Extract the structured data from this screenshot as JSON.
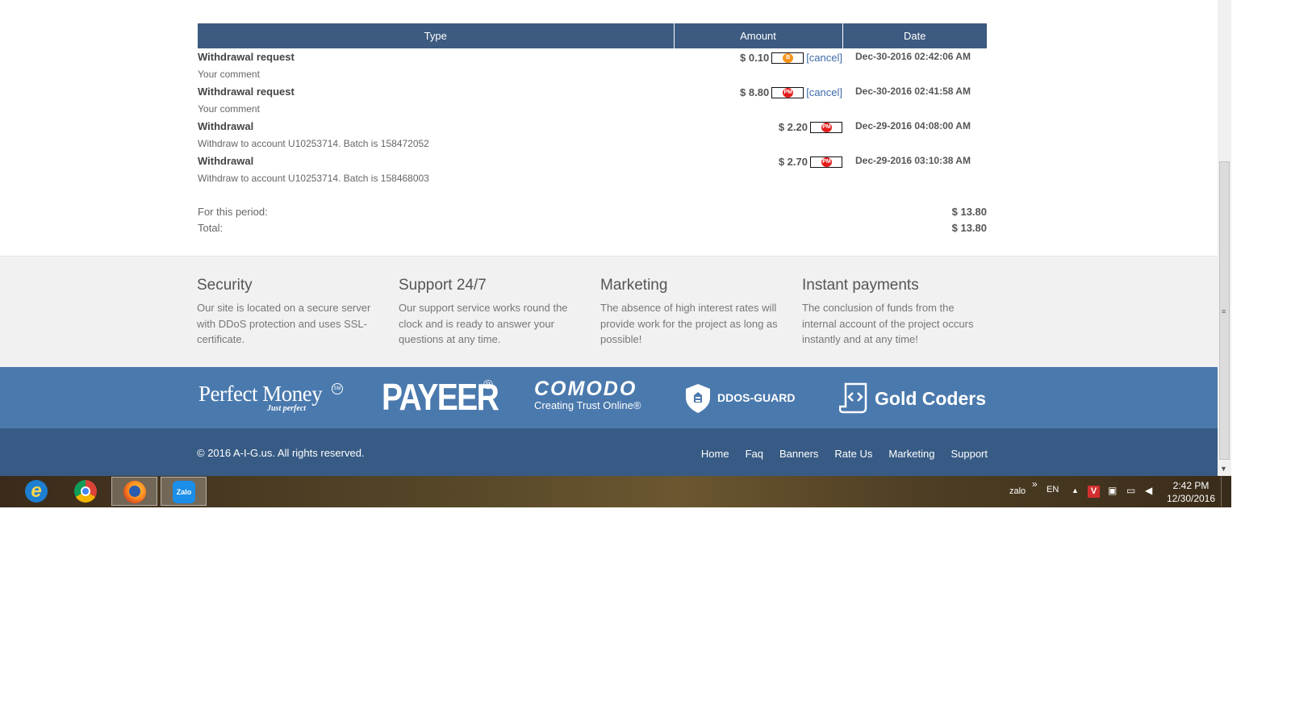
{
  "table": {
    "headers": [
      "Type",
      "Amount",
      "Date"
    ],
    "rows": [
      {
        "title": "Withdrawal request",
        "comment": "Your comment",
        "amount": "$ 0.10",
        "system": "bitcoin-icon",
        "cancel": "[cancel]",
        "date": "Dec-30-2016 02:42:06 AM"
      },
      {
        "title": "Withdrawal request",
        "comment": "Your comment",
        "amount": "$ 8.80",
        "system": "perfect-money-icon",
        "cancel": "[cancel]",
        "date": "Dec-30-2016 02:41:58 AM"
      },
      {
        "title": "Withdrawal",
        "comment": "Withdraw to account U10253714. Batch is 158472052",
        "amount": "$ 2.20",
        "system": "perfect-money-icon",
        "cancel": "",
        "date": "Dec-29-2016 04:08:00 AM"
      },
      {
        "title": "Withdrawal",
        "comment": "Withdraw to account U10253714. Batch is 158468003",
        "amount": "$ 2.70",
        "system": "perfect-money-icon",
        "cancel": "",
        "date": "Dec-29-2016 03:10:38 AM"
      }
    ],
    "coin_btc": "B",
    "coin_pm": "PM",
    "summary": {
      "period_label": "For this period:",
      "period_value": "$ 13.80",
      "total_label": "Total:",
      "total_value": "$ 13.80"
    }
  },
  "features": [
    {
      "title": "Security",
      "text": "Our site is located on a secure server with DDoS protection and uses SSL-certificate."
    },
    {
      "title": "Support 24/7",
      "text": "Our support service works round the clock and is ready to answer your questions at any time."
    },
    {
      "title": "Marketing",
      "text": "The absence of high interest rates will provide work for the project as long as possible!"
    },
    {
      "title": "Instant payments",
      "text": "The conclusion of funds from the internal account of the project occurs instantly and at any time!"
    }
  ],
  "partners": {
    "perfect_money": {
      "name": "Perfect Money",
      "tag": "Just perfect",
      "mark": "SM"
    },
    "payeer": {
      "name": "PAYEER",
      "mark": "®"
    },
    "comodo": {
      "name": "COMODO",
      "tag": "Creating Trust Online®"
    },
    "ddos_guard": {
      "name": "DDOS-GUARD"
    },
    "gold_coders": {
      "name": "Gold Coders"
    }
  },
  "footer": {
    "copyright": "© 2016 A-I-G.us. All rights reserved.",
    "nav": [
      "Home",
      "Faq",
      "Banners",
      "Rate Us",
      "Marketing",
      "Support"
    ]
  },
  "taskbar": {
    "tray_label": "zalo",
    "tray_chevron": "»",
    "language": "EN",
    "time": "2:42 PM",
    "date": "12/30/2016",
    "zalo_label": "Zalo"
  },
  "colors": {
    "table_header": "#3d5a80",
    "partners_band": "#4a79ad",
    "footer_bar": "#375b84",
    "link": "#3d6aa8"
  }
}
